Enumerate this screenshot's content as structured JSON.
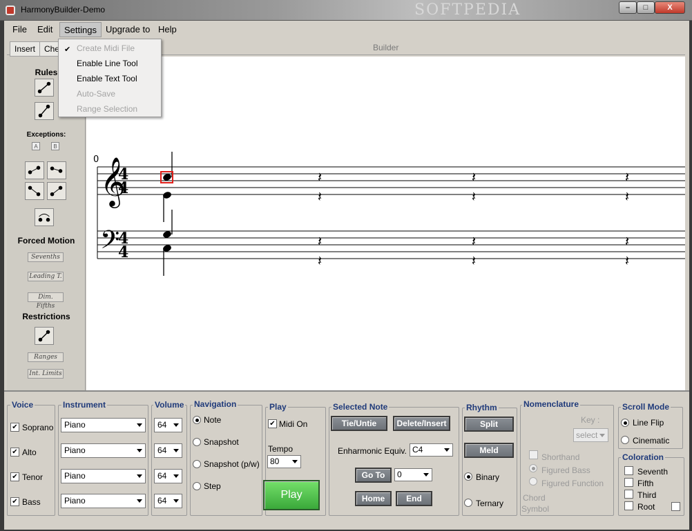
{
  "window": {
    "title": "HarmonyBuilder-Demo",
    "watermark": "SOFTPEDIA",
    "min": "–",
    "max": "□",
    "close": "X"
  },
  "menu": {
    "file": "File",
    "edit": "Edit",
    "settings": "Settings",
    "upgrade": "Upgrade to",
    "help": "Help"
  },
  "settings_menu": {
    "items": [
      "Create Midi File",
      "Enable Line Tool",
      "Enable Text Tool",
      "Auto-Save",
      "Range Selection"
    ]
  },
  "tabs": {
    "insert": "Insert",
    "check": "Che",
    "builder": "Builder"
  },
  "left": {
    "rules": "Rules",
    "exceptions": "Exceptions:",
    "exc_a": "A",
    "exc_b": "B",
    "forced_motion": "Forced Motion",
    "sevenths": "Sevenths",
    "leading": "Leading T.",
    "dim_fifths": "Dim. Fifths",
    "restrictions": "Restrictions",
    "ranges": "Ranges",
    "int_limits": "Int. Limits"
  },
  "score": {
    "measure_number": "0"
  },
  "voice": {
    "title": "Voice",
    "items": [
      "Soprano",
      "Alto",
      "Tenor",
      "Bass"
    ]
  },
  "instrument": {
    "title": "Instrument",
    "values": [
      "Piano",
      "Piano",
      "Piano",
      "Piano"
    ]
  },
  "volume": {
    "title": "Volume",
    "values": [
      "64",
      "64",
      "64",
      "64"
    ]
  },
  "navigation": {
    "title": "Navigation",
    "options": [
      "Note",
      "Snapshot",
      "Snapshot (p/w)",
      "Step"
    ],
    "selected": "Note"
  },
  "play": {
    "title": "Play",
    "midi_on": "Midi On",
    "tempo_label": "Tempo",
    "tempo": "80",
    "play_label": "Play"
  },
  "selected_note": {
    "title": "Selected Note",
    "tie": "Tie/Untie",
    "delete": "Delete/Insert",
    "enharmonic_label": "Enharmonic Equiv.",
    "enharmonic_value": "C4",
    "goto": "Go To",
    "goto_value": "0",
    "home": "Home",
    "end": "End"
  },
  "rhythm": {
    "title": "Rhythm",
    "split": "Split",
    "meld": "Meld",
    "binary": "Binary",
    "ternary": "Ternary"
  },
  "nomenclature": {
    "title": "Nomenclature",
    "key_label": "Key :",
    "key_value": "select",
    "shorthand": "Shorthand",
    "figured_bass": "Figured Bass",
    "figured_function": "Figured Function",
    "chord_symbol_1": "Chord",
    "chord_symbol_2": "Symbol"
  },
  "scroll_mode": {
    "title": "Scroll Mode",
    "line_flip": "Line Flip",
    "cinematic": "Cinematic"
  },
  "coloration": {
    "title": "Coloration",
    "items": [
      "Seventh",
      "Fifth",
      "Third",
      "Root"
    ]
  }
}
